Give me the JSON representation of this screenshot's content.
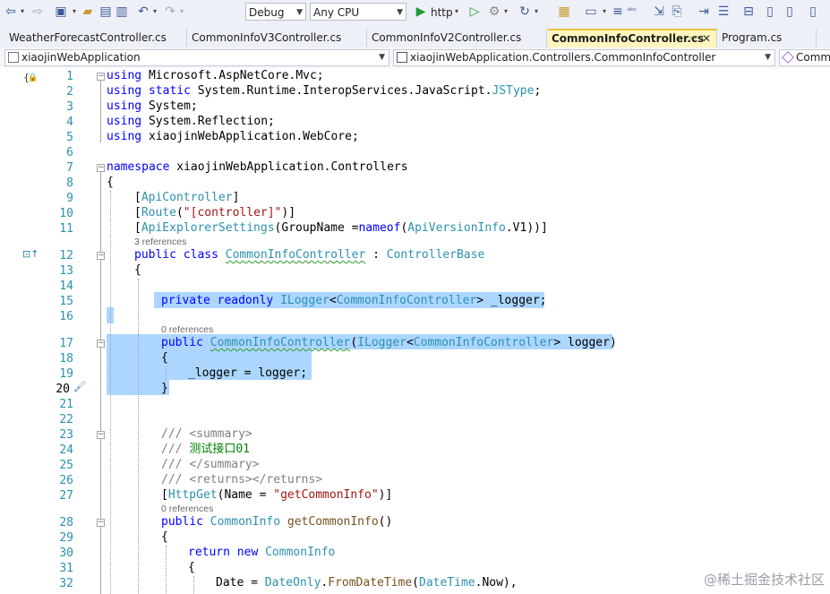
{
  "toolbar": {
    "config": "Debug",
    "platform": "Any CPU",
    "run_label": "http"
  },
  "tabs": [
    {
      "label": "WeatherForecastController.cs"
    },
    {
      "label": "CommonInfoV3Controller.cs"
    },
    {
      "label": "CommonInfoV2Controller.cs"
    },
    {
      "label": "CommonInfoController.cs",
      "active": true
    },
    {
      "label": "Program.cs"
    }
  ],
  "navbar": {
    "project": "xiaojinWebApplication",
    "type": "xiaojinWebApplication.Controllers.CommonInfoController",
    "member": "Comm"
  },
  "editor": {
    "line_numbers": [
      "1",
      "2",
      "3",
      "4",
      "5",
      "6",
      "7",
      "8",
      "9",
      "10",
      "11",
      "12",
      "13",
      "14",
      "15",
      "16",
      "17",
      "18",
      "19",
      "20",
      "21",
      "22",
      "23",
      "24",
      "25",
      "26",
      "27",
      "28",
      "29",
      "30",
      "31",
      "32"
    ],
    "references": [
      "3 references",
      "0 references",
      "0 references"
    ],
    "lines": {
      "l1a": "using",
      "l1b": " Microsoft.AspNetCore.Mvc;",
      "l2a": "using static",
      "l2b": " System.Runtime.InteropServices.JavaScript.",
      "l2c": "JSType",
      "l2d": ";",
      "l3a": "using",
      "l3b": " System;",
      "l4a": "using",
      "l4b": " System.Reflection;",
      "l5a": "using",
      "l5b": " xiaojinWebApplication.WebCore;",
      "l7a": "namespace",
      "l7b": " xiaojinWebApplication.Controllers",
      "l8": "{",
      "l9a": "[",
      "l9b": "ApiController",
      "l9c": "]",
      "l10a": "[",
      "l10b": "Route",
      "l10c": "(",
      "l10d": "\"[controller]\"",
      "l10e": ")]",
      "l11a": "[",
      "l11b": "ApiExplorerSettings",
      "l11c": "(GroupName =",
      "l11d": "nameof",
      "l11e": "(",
      "l11f": "ApiVersionInfo",
      "l11g": ".V1))]",
      "l12a": "public class",
      "l12b": " ",
      "l12c": "CommonInfoController",
      "l12d": " : ",
      "l12e": "ControllerBase",
      "l13": "{",
      "l15a": "private readonly",
      "l15b": " ",
      "l15c": "ILogger",
      "l15d": "<",
      "l15e": "CommonInfoController",
      "l15f": "> _logger;",
      "l17a": "public",
      "l17b": " ",
      "l17c": "CommonInfoController",
      "l17d": "(",
      "l17e": "ILogger",
      "l17f": "<",
      "l17g": "CommonInfoController",
      "l17h": "> logger)",
      "l18": "{",
      "l19": "_logger = logger;",
      "l20": "}",
      "l23a": "/// ",
      "l23b": "<summary>",
      "l24a": "/// ",
      "l24b": "测试接口01",
      "l25a": "/// ",
      "l25b": "</summary>",
      "l26a": "/// ",
      "l26b": "<returns></returns>",
      "l27a": "[",
      "l27b": "HttpGet",
      "l27c": "(Name = ",
      "l27d": "\"getCommonInfo\"",
      "l27e": ")]",
      "l28a": "public",
      "l28b": " ",
      "l28c": "CommonInfo",
      "l28d": " ",
      "l28e": "getCommonInfo",
      "l28f": "()",
      "l29": "{",
      "l30a": "return new",
      "l30b": " ",
      "l30c": "CommonInfo",
      "l31": "{",
      "l32a": "Date = ",
      "l32b": "DateOnly",
      "l32c": ".",
      "l32d": "FromDateTime",
      "l32e": "(",
      "l32f": "DateTime",
      "l32g": ".Now),"
    }
  },
  "watermark": "@稀土掘金技术社区"
}
